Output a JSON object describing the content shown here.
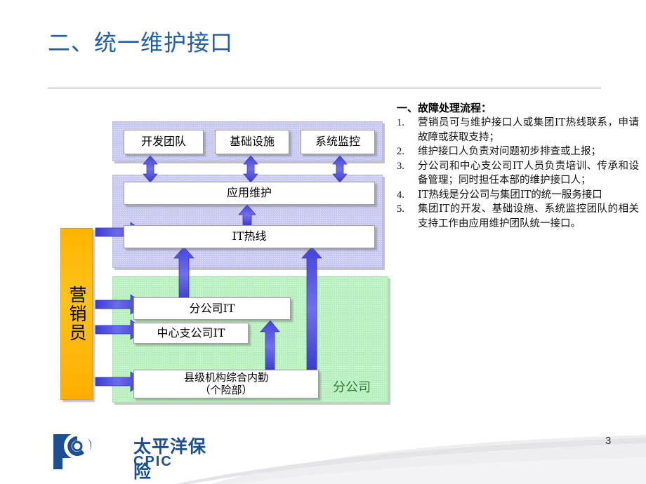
{
  "slide": {
    "title": "二、统一维护接口",
    "page_number": "3"
  },
  "notes": {
    "heading": "一、故障处理流程：",
    "items": [
      {
        "num": "1.",
        "text": "营销员可与维护接口人或集团IT热线联系，申请故障或获取支持；"
      },
      {
        "num": "2.",
        "text": "维护接口人负责对问题初步排查或上报；"
      },
      {
        "num": "3.",
        "text": "分公司和中心支公司IT人员负责培训、传承和设备管理；同时担任本部的维护接口人；"
      },
      {
        "num": "4.",
        "text": "IT热线是分公司与集团IT的统一服务接口"
      },
      {
        "num": "5.",
        "text": "集团IT的开发、基础设施、系统监控团队的相关支持工作由应用维护团队统一接口。"
      }
    ]
  },
  "diagram": {
    "actor": {
      "label": "营销员"
    },
    "group_top": {
      "boxes": [
        {
          "label": "开发团队"
        },
        {
          "label": "基础设施"
        },
        {
          "label": "系统监控"
        }
      ]
    },
    "group_mid": {
      "boxes": [
        {
          "label": "应用维护"
        },
        {
          "label": "IT热线"
        }
      ]
    },
    "group_branch": {
      "label": "分公司",
      "boxes": [
        {
          "label": "分公司IT"
        },
        {
          "label": "中心支公司IT"
        },
        {
          "label": "县级机构综合内勤\n（个险部）"
        }
      ]
    }
  },
  "footer": {
    "logo_cn": "太平洋保险",
    "logo_en": "CPIC"
  },
  "colors": {
    "title_blue": "#1F5FA8",
    "panel_purple": "#c9c9f2",
    "panel_green": "#b9f0bf",
    "actor_orange": "#FFB400",
    "arrow_blue": "#4a4ae0",
    "brand_blue": "#1b4f91",
    "branch_label_green": "#2f7d3a"
  }
}
